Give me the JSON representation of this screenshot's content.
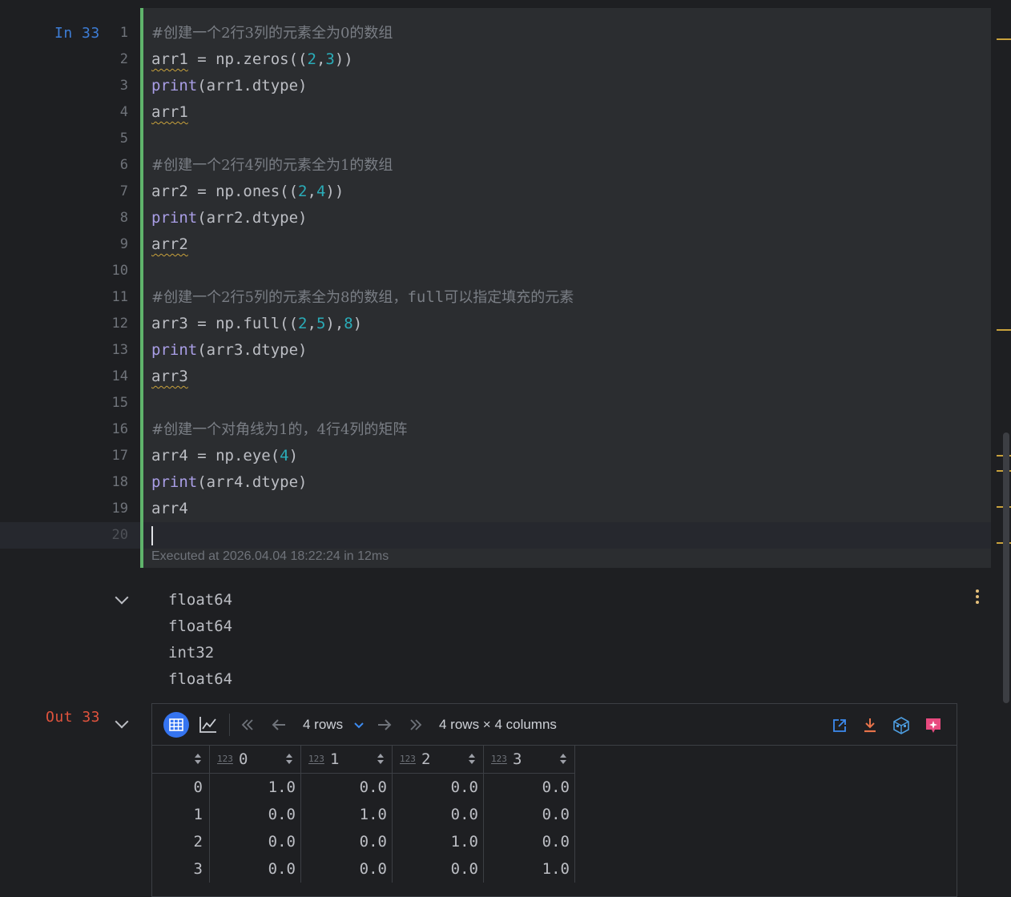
{
  "cell_in": {
    "label": "In 33",
    "line_numbers": [
      "1",
      "2",
      "3",
      "4",
      "5",
      "6",
      "7",
      "8",
      "9",
      "10",
      "11",
      "12",
      "13",
      "14",
      "15",
      "16",
      "17",
      "18",
      "19",
      "20"
    ],
    "code": {
      "l1": "#创建一个2行3列的元素全为0的数组",
      "l2_a": "arr1",
      "l2_b": " = np.zeros((",
      "l2_c": "2",
      "l2_d": ",",
      "l2_e": "3",
      "l2_f": "))",
      "l3_a": "print",
      "l3_b": "(arr1.dtype)",
      "l4": "arr1",
      "l6": "#创建一个2行4列的元素全为1的数组",
      "l7_a": "arr2 = np.ones((",
      "l7_b": "2",
      "l7_c": ",",
      "l7_d": "4",
      "l7_e": "))",
      "l8_a": "print",
      "l8_b": "(arr2.dtype)",
      "l9": "arr2",
      "l11_a": "#创建一个2行5列的元素全为8的数组，",
      "l11_b": "full",
      "l11_c": "可以指定填充的元素",
      "l12_a": "arr3 = np.full((",
      "l12_b": "2",
      "l12_c": ",",
      "l12_d": "5",
      "l12_e": "),",
      "l12_f": "8",
      "l12_g": ")",
      "l13_a": "print",
      "l13_b": "(arr3.dtype)",
      "l14": "arr3",
      "l16": "#创建一个对角线为1的，4行4列的矩阵",
      "l17_a": "arr4 = np.eye(",
      "l17_b": "4",
      "l17_c": ")",
      "l18_a": "print",
      "l18_b": "(arr4.dtype)",
      "l19": "arr4"
    },
    "executed": "Executed at 2026.04.04 18:22:24 in 12ms"
  },
  "stdout": [
    "float64",
    "float64",
    "int32",
    "float64"
  ],
  "cell_out": {
    "label": "Out 33",
    "toolbar": {
      "rows_select": "4 rows",
      "shape": "4 rows × 4 columns"
    },
    "table": {
      "type_badge": "123",
      "columns": [
        "0",
        "1",
        "2",
        "3"
      ],
      "index": [
        "0",
        "1",
        "2",
        "3"
      ],
      "rows": [
        [
          "1.0",
          "0.0",
          "0.0",
          "0.0"
        ],
        [
          "0.0",
          "1.0",
          "0.0",
          "0.0"
        ],
        [
          "0.0",
          "0.0",
          "1.0",
          "0.0"
        ],
        [
          "0.0",
          "0.0",
          "0.0",
          "1.0"
        ]
      ]
    }
  },
  "colors": {
    "cell_bar": "#5fb36b",
    "in_label": "#3d7dd6",
    "out_label": "#e0533d",
    "keyword": "#a99ee6",
    "number": "#2aacb8",
    "comment": "#7a7e85"
  },
  "icons": [
    "table-view-icon",
    "chart-view-icon",
    "first-page-icon",
    "prev-page-icon",
    "next-page-icon",
    "last-page-icon",
    "open-external-icon",
    "download-icon",
    "export-icon",
    "ai-icon"
  ]
}
